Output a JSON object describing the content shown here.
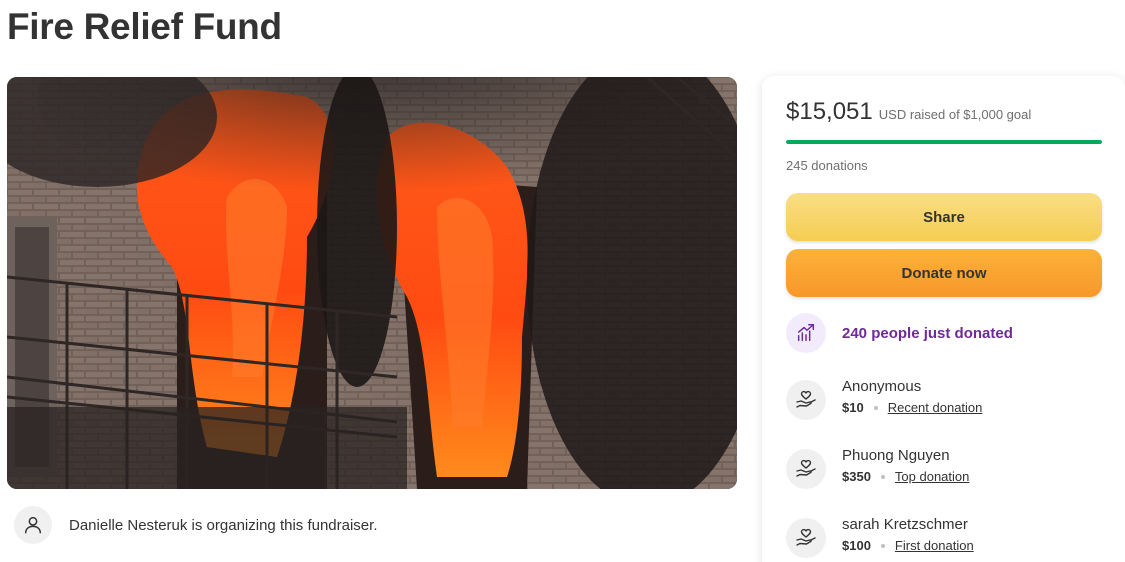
{
  "page": {
    "title": "Fire Relief Fund"
  },
  "hero": {
    "image": "building-fire-photo"
  },
  "organizer": {
    "text": "Danielle Nesteruk is organizing this fundraiser.",
    "icon": "person-icon"
  },
  "summary": {
    "raised": "$15,051",
    "raised_suffix": "USD raised of $1,000 goal",
    "progress": 1.0,
    "donations": "245 donations",
    "accent": "#02a95c"
  },
  "buttons": {
    "share": "Share",
    "donate": "Donate now"
  },
  "trend": {
    "text": "240 people just donated",
    "icon": "trending-up-icon",
    "color": "#6e2b96"
  },
  "donors": [
    {
      "name": "Anonymous",
      "amount": "$10",
      "tag": "Recent donation",
      "icon": "heart-hand-icon"
    },
    {
      "name": "Phuong Nguyen",
      "amount": "$350",
      "tag": "Top donation",
      "icon": "heart-hand-icon"
    },
    {
      "name": "sarah Kretzschmer",
      "amount": "$100",
      "tag": "First donation",
      "icon": "heart-hand-icon"
    }
  ]
}
